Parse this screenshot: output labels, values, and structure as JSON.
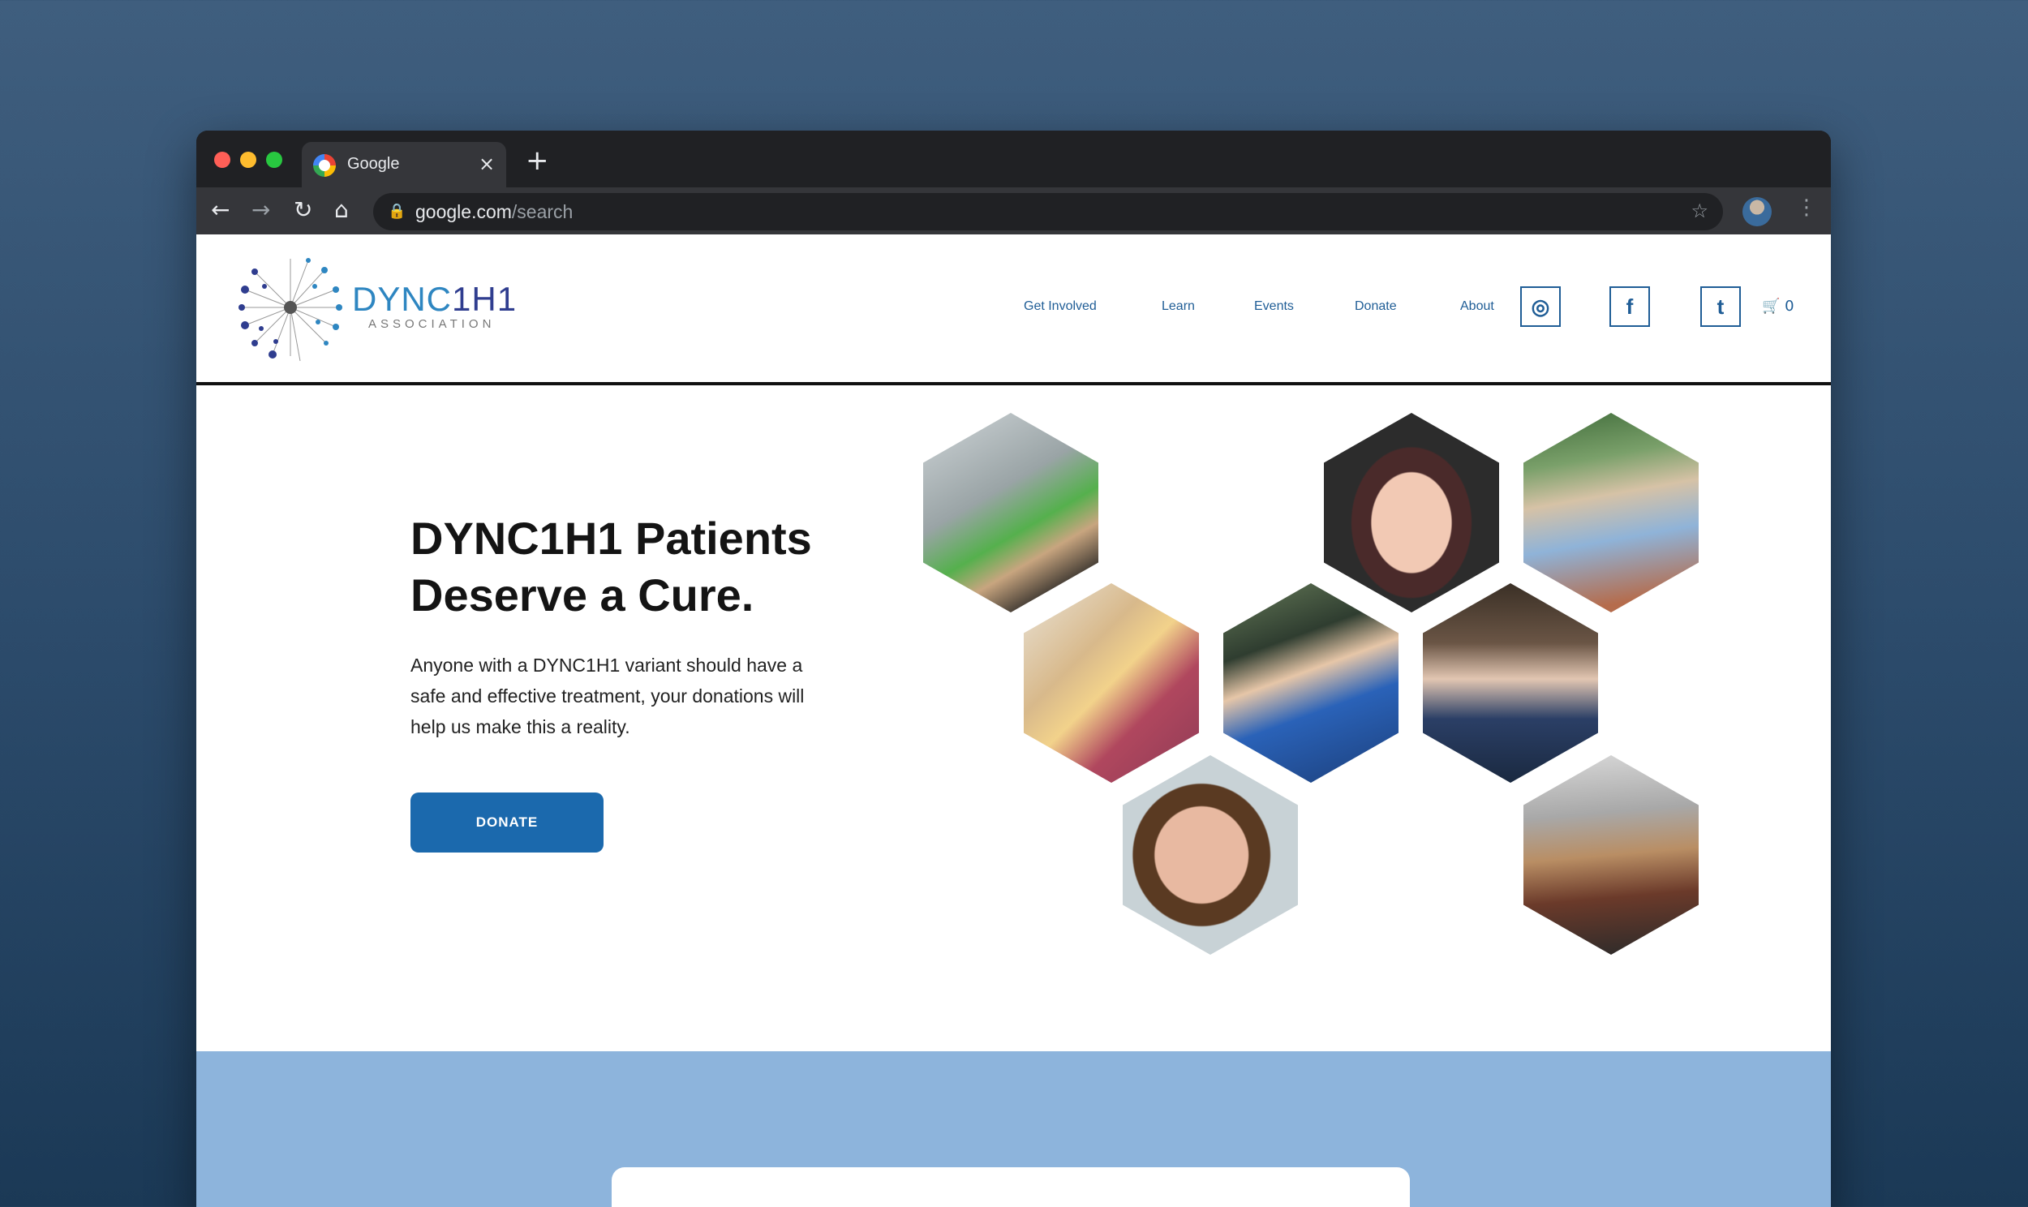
{
  "browser": {
    "tab_title": "Google",
    "tab_close": "×",
    "new_tab": "+",
    "url_host": "google.com",
    "url_path": "/search",
    "back": "←",
    "forward": "→",
    "reload": "↻",
    "home": "⌂",
    "lock": "🔒",
    "star": "☆",
    "menu": "⋮"
  },
  "site": {
    "logo": {
      "text_main": "DYNC",
      "text_num1": "1",
      "text_h": "H",
      "text_num2": "1",
      "subtitle": "ASSOCIATION"
    },
    "nav": [
      "Get Involved",
      "Learn",
      "Events",
      "Donate",
      "About"
    ],
    "social": {
      "instagram": "◎",
      "facebook": "f",
      "twitter": "t"
    },
    "cart": {
      "icon": "🛒",
      "count": "0"
    }
  },
  "hero": {
    "title": "DYNC1H1 Patients Deserve a Cure.",
    "text": "Anyone with a DYNC1H1 variant should have a safe and effective treatment, your donations will help us make this a reality.",
    "button": "DONATE"
  },
  "colors": {
    "brand_blue": "#1b69ad",
    "logo_blue": "#2e86c1",
    "logo_dark": "#2f3d8f",
    "band": "#8db4dc"
  }
}
